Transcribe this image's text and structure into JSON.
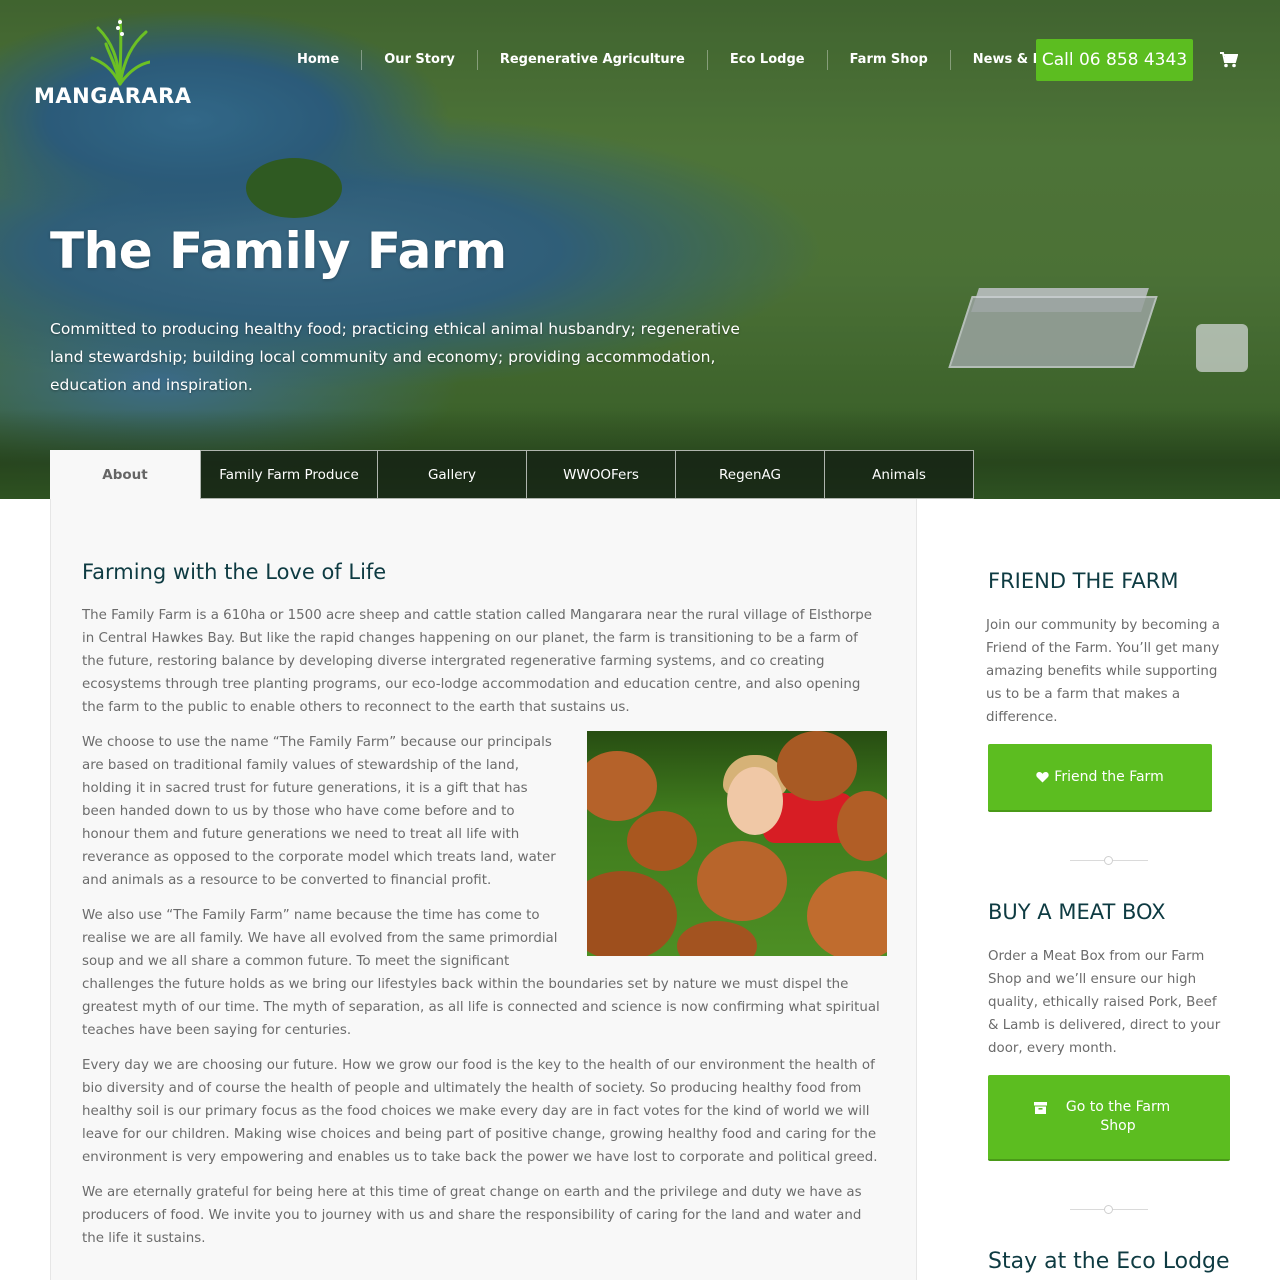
{
  "brand": {
    "name": "MANGARARA"
  },
  "nav": {
    "items": [
      "Home",
      "Our Story",
      "Regenerative Agriculture",
      "Eco Lodge",
      "Farm Shop",
      "News & Events"
    ]
  },
  "header": {
    "call_label": "Call 06 858 4343",
    "cart_icon": "shopping-cart-icon"
  },
  "hero": {
    "title": "The Family Farm",
    "subtitle": "Committed to producing healthy food; practicing ethical animal husbandry; regenerative land stewardship; building local community and economy; providing accommodation, education and inspiration."
  },
  "tabs": [
    "About",
    "Family Farm Produce",
    "Gallery",
    "WWOOFers",
    "RegenAG",
    "Animals"
  ],
  "main": {
    "heading": "Farming with the Love of Life",
    "paragraphs": [
      "The Family Farm is a 610ha or 1500 acre sheep and cattle station called Mangarara near the rural village of Elsthorpe in Central Hawkes Bay. But like the rapid changes happening on our planet, the farm is transitioning to be a farm of the future, restoring balance by developing diverse intergrated regenerative farming systems, and co creating ecosystems through tree planting programs, our eco-lodge accommodation and education centre, and also opening the farm to the public to enable others to reconnect to the earth that sustains us.",
      "We choose to use the name “The Family Farm” because our principals are based on traditional family values of stewardship of the land, holding it in sacred trust for future generations, it is a gift that has been handed down to us by those who have come before and to honour them and future generations we need to treat all life with reverance as opposed to the corporate model which treats land, water and animals as a resource to be converted to financial profit.",
      "We also use “The Family Farm” name because the time has come to realise we are all family. We have all evolved from the same primordial soup and we all share a common future. To meet the significant challenges the future holds as we bring our lifestyles back within the boundaries set by nature we must dispel the greatest myth of our time. The myth of separation, as all life is connected and science is now confirming what spiritual teaches have been saying for centuries.",
      "Every day we are choosing our future. How we grow our food is the key to the health of our environment the health of bio diversity and of course the health of people and ultimately the health of society. So producing healthy food from healthy soil is our primary focus as the food choices we make every day are in fact votes for the kind of world we will leave for our children. Making wise choices and being part of positive change, growing healthy food and caring for the environment is very empowering and enables us to take back the power we have lost to corporate and political greed.",
      "We are eternally grateful for being here at this time of great change on earth and the privilege and duty we have as producers of food. We invite you to journey with us and share the responsibility of caring for the land and water and the life it sustains."
    ]
  },
  "sidebar": {
    "friend": {
      "heading": "FRIEND THE FARM",
      "text": "Join our community by becoming a Friend of the Farm. You’ll get many amazing benefits while supporting us to be a farm that makes a difference.",
      "button": "Friend the Farm",
      "icon": "heart-icon"
    },
    "meatbox": {
      "heading": "BUY A MEAT BOX",
      "text": "Order a Meat Box from our Farm Shop and we’ll ensure our high quality, ethically raised Pork, Beef & Lamb is delivered, direct to your door, every month.",
      "button": "Go to the Farm Shop",
      "icon": "archive-box-icon"
    },
    "ecolodge": {
      "heading": "Stay at the Eco Lodge"
    }
  },
  "colors": {
    "accent_green": "#5cbd20",
    "heading_teal": "#0e3b42",
    "body_text": "#6b6b6b"
  }
}
